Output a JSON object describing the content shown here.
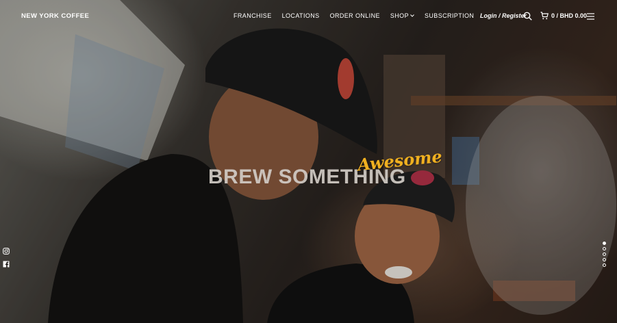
{
  "header": {
    "logo": "NEW YORK COFFEE",
    "nav": [
      {
        "label": "FRANCHISE"
      },
      {
        "label": "LOCATIONS"
      },
      {
        "label": "ORDER ONLINE"
      },
      {
        "label": "SHOP"
      },
      {
        "label": "SUBSCRIPTION"
      }
    ],
    "login": "Login / Register",
    "cart": "0 / BHD 0.00"
  },
  "hero": {
    "headline": "BREW SOMETHING",
    "accent": "Awesome",
    "accent_color": "#f0b020"
  },
  "icons": {
    "search": "search-icon",
    "cart": "cart-icon",
    "menu": "menu-icon",
    "social": [
      "instagram-icon",
      "facebook-icon"
    ]
  },
  "slider": {
    "count": 5,
    "active_index": 0
  }
}
